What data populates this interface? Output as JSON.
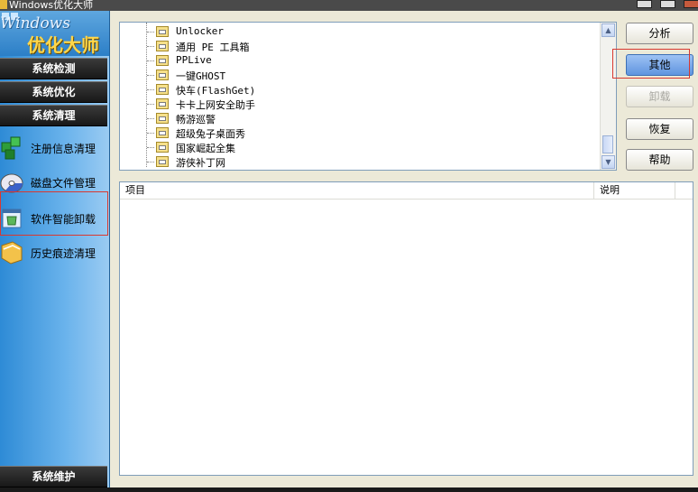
{
  "window": {
    "title": "Windows优化大师"
  },
  "logo": {
    "line1": "Windows",
    "line2": "优化大师"
  },
  "sidebar": {
    "sections": [
      {
        "label": "系统检测"
      },
      {
        "label": "系统优化"
      },
      {
        "label": "系统清理"
      }
    ],
    "items": [
      {
        "label": "注册信息清理",
        "icon": "registry-icon"
      },
      {
        "label": "磁盘文件管理",
        "icon": "disk-icon"
      },
      {
        "label": "软件智能卸载",
        "icon": "uninstall-icon",
        "highlighted": true
      },
      {
        "label": "历史痕迹清理",
        "icon": "history-icon"
      }
    ],
    "footer": {
      "label": "系统维护"
    }
  },
  "tree": {
    "items": [
      "Unlocker",
      "通用 PE 工具箱",
      "PPLive",
      "一键GHOST",
      "快车(FlashGet)",
      "卡卡上网安全助手",
      "畅游巡警",
      "超级兔子桌面秀",
      "国家崛起全集",
      "游侠补丁网"
    ]
  },
  "buttons": {
    "analyze": "分析",
    "other": "其他",
    "uninstall": "卸载",
    "restore": "恢复",
    "help": "帮助"
  },
  "list": {
    "columns": [
      "项目",
      "说明"
    ],
    "rows": []
  },
  "colors": {
    "highlight_box": "#d9382f",
    "selected_button": "#5f95df",
    "sidebar_section": "#1f1f1f"
  }
}
